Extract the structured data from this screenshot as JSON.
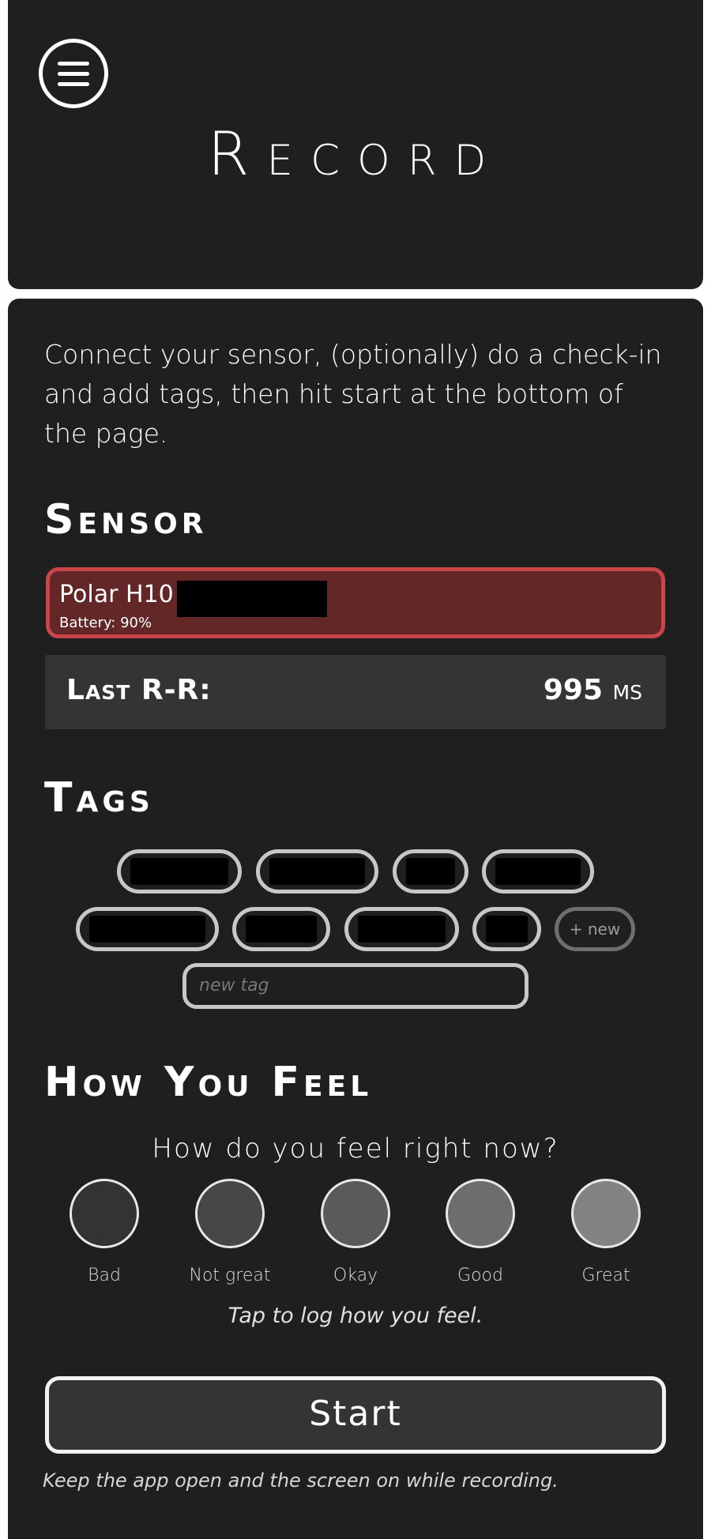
{
  "header": {
    "title": "Record",
    "menu_icon": "hamburger-menu-icon"
  },
  "intro": "Connect your sensor, (optionally) do a check-in and add tags, then hit start at the bottom of the page.",
  "sensor": {
    "section_title": "Sensor",
    "device_name": "Polar H10",
    "battery": "Battery: 90%",
    "status_colors": {
      "border": "#c8454a",
      "fill": "#632727"
    },
    "last_rr_label": "Last R-R:",
    "last_rr_value": "995",
    "last_rr_unit": "ms"
  },
  "tags": {
    "section_title": "Tags",
    "new_chip_label": "+ new",
    "new_tag_placeholder": "new tag"
  },
  "feel": {
    "section_title": "How You Feel",
    "question": "How do you feel right now?",
    "options": [
      {
        "label": "Bad",
        "color": "#333333"
      },
      {
        "label": "Not great",
        "color": "#474747"
      },
      {
        "label": "Okay",
        "color": "#5a5a5a"
      },
      {
        "label": "Good",
        "color": "#6d6d6d"
      },
      {
        "label": "Great",
        "color": "#838383"
      }
    ],
    "hint": "Tap to log how you feel."
  },
  "start": {
    "button_label": "Start",
    "note": "Keep the app open and the screen on while recording."
  }
}
